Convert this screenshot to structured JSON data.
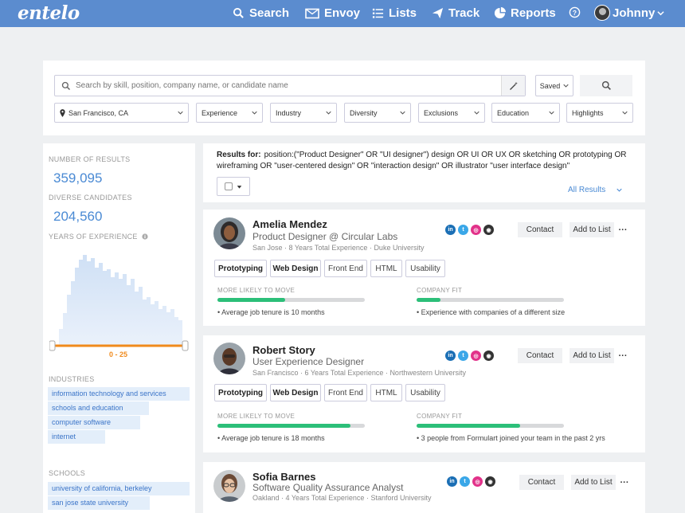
{
  "nav": {
    "logo": "entelo",
    "items": [
      {
        "label": "Search",
        "icon": "search-icon"
      },
      {
        "label": "Envoy",
        "icon": "envoy-icon"
      },
      {
        "label": "Lists",
        "icon": "list-icon"
      },
      {
        "label": "Track",
        "icon": "send-icon"
      },
      {
        "label": "Reports",
        "icon": "pie-chart-icon"
      }
    ],
    "user": "Johnny"
  },
  "search": {
    "placeholder": "Search by skill, position, company name, or candidate name",
    "saved_label": "Saved",
    "filters": [
      "San Francisco, CA",
      "Experience",
      "Industry",
      "Diversity",
      "Exclusions",
      "Education",
      "Highlights"
    ]
  },
  "sidebar": {
    "results_label": "Number of Results",
    "results_value": "359,095",
    "diverse_label": "Diverse Candidates",
    "diverse_value": "204,560",
    "experience_label": "Years of Experience",
    "experience_range": "0 - 25",
    "industries_label": "Industries",
    "industries": [
      {
        "label": "information technology and services",
        "share": 1.0
      },
      {
        "label": "schools and education",
        "share": 0.71
      },
      {
        "label": "computer software",
        "share": 0.65
      },
      {
        "label": "internet",
        "share": 0.4
      }
    ],
    "schools_label": "Schools",
    "schools": [
      {
        "label": "university of california, berkeley",
        "share": 1.0
      },
      {
        "label": "san jose state university",
        "share": 0.72
      }
    ]
  },
  "results": {
    "label": "Results for:",
    "query": "position:(\"Product Designer\" OR \"UI designer\") design OR UI OR UX OR sketching OR prototyping OR wireframing OR \"user-centered design\" OR \"interaction design\" OR illustrator \"user interface design\"",
    "all_results": "All Results"
  },
  "card_labels": {
    "contact": "Contact",
    "add_to_list": "Add to List",
    "move_label": "More Likely to Move",
    "fit_label": "Company Fit"
  },
  "candidates": [
    {
      "name": "Amelia Mendez",
      "title": "Product Designer @ Circular Labs",
      "location": "San Jose",
      "experience": "8 Years Total Experience",
      "school": "Duke University",
      "tags": [
        "Prototyping",
        "Web Design",
        "Front End",
        "HTML",
        "Usability"
      ],
      "move": 0.46,
      "move_note": "Average job tenure is 10 months",
      "fit": 0.16,
      "fit_note": "Experience with companies of a different size"
    },
    {
      "name": "Robert Story",
      "title": "User Experience Designer",
      "location": "San Francisco",
      "experience": "6 Years Total Experience",
      "school": "Northwestern University",
      "tags": [
        "Prototyping",
        "Web Design",
        "Front End",
        "HTML",
        "Usability"
      ],
      "move": 0.9,
      "move_note": "Average job tenure is 18 months",
      "fit": 0.7,
      "fit_note": "3 people from Formulart joined your team in the past 2 yrs"
    },
    {
      "name": "Sofia Barnes",
      "title": "Software Quality Assurance Analyst",
      "location": "Oakland",
      "experience": "4 Years Total Experience",
      "school": "Stanford University"
    }
  ],
  "colors": {
    "nav": "#5b8ccf",
    "accent": "#4a8ad4",
    "bar": "#2cbf79",
    "histogram": "#d6e4f5",
    "slider": "#f08a1c"
  }
}
